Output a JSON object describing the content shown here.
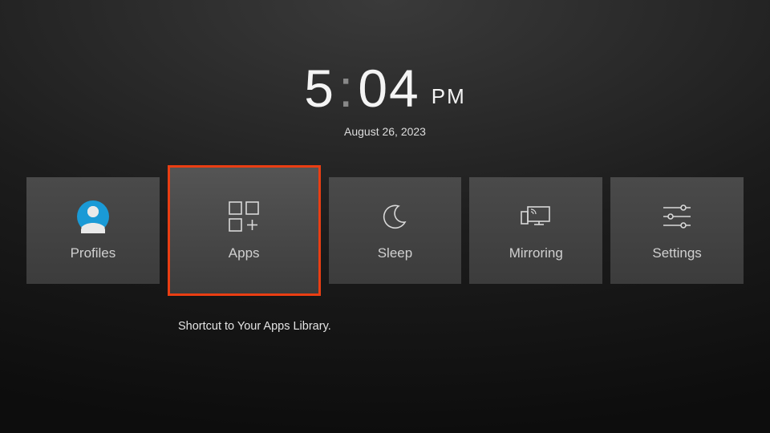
{
  "clock": {
    "hour": "5",
    "minute": "04",
    "meridiem": "PM",
    "date": "August 26, 2023"
  },
  "tiles": {
    "profiles": {
      "label": "Profiles"
    },
    "apps": {
      "label": "Apps",
      "tooltip": "Shortcut to Your Apps Library."
    },
    "sleep": {
      "label": "Sleep"
    },
    "mirroring": {
      "label": "Mirroring"
    },
    "settings": {
      "label": "Settings"
    }
  },
  "selected_tile": "apps"
}
